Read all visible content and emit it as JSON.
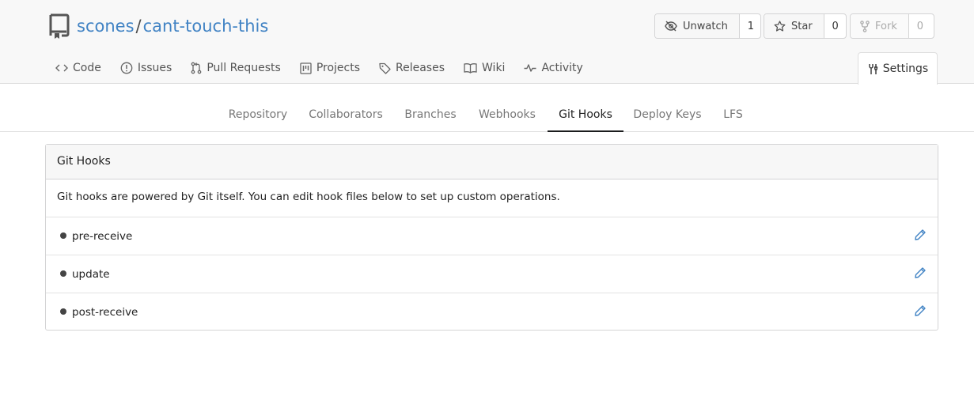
{
  "repo": {
    "owner": "scones",
    "separator": "/",
    "name": "cant-touch-this",
    "icon": "repo-icon"
  },
  "actions": {
    "watch": {
      "label": "Unwatch",
      "count": "1",
      "icon": "eye-slash-icon"
    },
    "star": {
      "label": "Star",
      "count": "0",
      "icon": "star-icon"
    },
    "fork": {
      "label": "Fork",
      "count": "0",
      "icon": "fork-icon"
    }
  },
  "repo_tabs": [
    {
      "label": "Code",
      "icon": "code-icon"
    },
    {
      "label": "Issues",
      "icon": "issue-icon"
    },
    {
      "label": "Pull Requests",
      "icon": "pull-request-icon"
    },
    {
      "label": "Projects",
      "icon": "project-icon"
    },
    {
      "label": "Releases",
      "icon": "tag-icon"
    },
    {
      "label": "Wiki",
      "icon": "book-icon"
    },
    {
      "label": "Activity",
      "icon": "pulse-icon"
    }
  ],
  "settings_tab": {
    "label": "Settings",
    "icon": "tools-icon"
  },
  "settings_subtabs": {
    "items": [
      "Repository",
      "Collaborators",
      "Branches",
      "Webhooks",
      "Git Hooks",
      "Deploy Keys",
      "LFS"
    ],
    "active": "Git Hooks"
  },
  "git_hooks": {
    "title": "Git Hooks",
    "description": "Git hooks are powered by Git itself. You can edit hook files below to set up custom operations.",
    "hooks": [
      {
        "name": "pre-receive"
      },
      {
        "name": "update"
      },
      {
        "name": "post-receive"
      }
    ]
  },
  "colors": {
    "link": "#4183c4",
    "header_bg": "#f8f8f8",
    "active_underline": "#1b1c1d"
  }
}
